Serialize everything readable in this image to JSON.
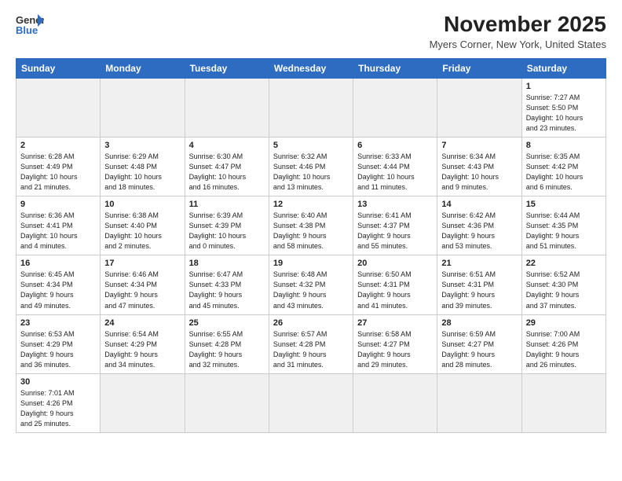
{
  "header": {
    "logo_text_general": "General",
    "logo_text_blue": "Blue",
    "month_title": "November 2025",
    "location": "Myers Corner, New York, United States"
  },
  "weekdays": [
    "Sunday",
    "Monday",
    "Tuesday",
    "Wednesday",
    "Thursday",
    "Friday",
    "Saturday"
  ],
  "weeks": [
    [
      {
        "day": "",
        "info": "",
        "empty": true
      },
      {
        "day": "",
        "info": "",
        "empty": true
      },
      {
        "day": "",
        "info": "",
        "empty": true
      },
      {
        "day": "",
        "info": "",
        "empty": true
      },
      {
        "day": "",
        "info": "",
        "empty": true
      },
      {
        "day": "",
        "info": "",
        "empty": true
      },
      {
        "day": "1",
        "info": "Sunrise: 7:27 AM\nSunset: 5:50 PM\nDaylight: 10 hours\nand 23 minutes.",
        "empty": false
      }
    ],
    [
      {
        "day": "2",
        "info": "Sunrise: 6:28 AM\nSunset: 4:49 PM\nDaylight: 10 hours\nand 21 minutes.",
        "empty": false
      },
      {
        "day": "3",
        "info": "Sunrise: 6:29 AM\nSunset: 4:48 PM\nDaylight: 10 hours\nand 18 minutes.",
        "empty": false
      },
      {
        "day": "4",
        "info": "Sunrise: 6:30 AM\nSunset: 4:47 PM\nDaylight: 10 hours\nand 16 minutes.",
        "empty": false
      },
      {
        "day": "5",
        "info": "Sunrise: 6:32 AM\nSunset: 4:46 PM\nDaylight: 10 hours\nand 13 minutes.",
        "empty": false
      },
      {
        "day": "6",
        "info": "Sunrise: 6:33 AM\nSunset: 4:44 PM\nDaylight: 10 hours\nand 11 minutes.",
        "empty": false
      },
      {
        "day": "7",
        "info": "Sunrise: 6:34 AM\nSunset: 4:43 PM\nDaylight: 10 hours\nand 9 minutes.",
        "empty": false
      },
      {
        "day": "8",
        "info": "Sunrise: 6:35 AM\nSunset: 4:42 PM\nDaylight: 10 hours\nand 6 minutes.",
        "empty": false
      }
    ],
    [
      {
        "day": "9",
        "info": "Sunrise: 6:36 AM\nSunset: 4:41 PM\nDaylight: 10 hours\nand 4 minutes.",
        "empty": false
      },
      {
        "day": "10",
        "info": "Sunrise: 6:38 AM\nSunset: 4:40 PM\nDaylight: 10 hours\nand 2 minutes.",
        "empty": false
      },
      {
        "day": "11",
        "info": "Sunrise: 6:39 AM\nSunset: 4:39 PM\nDaylight: 10 hours\nand 0 minutes.",
        "empty": false
      },
      {
        "day": "12",
        "info": "Sunrise: 6:40 AM\nSunset: 4:38 PM\nDaylight: 9 hours\nand 58 minutes.",
        "empty": false
      },
      {
        "day": "13",
        "info": "Sunrise: 6:41 AM\nSunset: 4:37 PM\nDaylight: 9 hours\nand 55 minutes.",
        "empty": false
      },
      {
        "day": "14",
        "info": "Sunrise: 6:42 AM\nSunset: 4:36 PM\nDaylight: 9 hours\nand 53 minutes.",
        "empty": false
      },
      {
        "day": "15",
        "info": "Sunrise: 6:44 AM\nSunset: 4:35 PM\nDaylight: 9 hours\nand 51 minutes.",
        "empty": false
      }
    ],
    [
      {
        "day": "16",
        "info": "Sunrise: 6:45 AM\nSunset: 4:34 PM\nDaylight: 9 hours\nand 49 minutes.",
        "empty": false
      },
      {
        "day": "17",
        "info": "Sunrise: 6:46 AM\nSunset: 4:34 PM\nDaylight: 9 hours\nand 47 minutes.",
        "empty": false
      },
      {
        "day": "18",
        "info": "Sunrise: 6:47 AM\nSunset: 4:33 PM\nDaylight: 9 hours\nand 45 minutes.",
        "empty": false
      },
      {
        "day": "19",
        "info": "Sunrise: 6:48 AM\nSunset: 4:32 PM\nDaylight: 9 hours\nand 43 minutes.",
        "empty": false
      },
      {
        "day": "20",
        "info": "Sunrise: 6:50 AM\nSunset: 4:31 PM\nDaylight: 9 hours\nand 41 minutes.",
        "empty": false
      },
      {
        "day": "21",
        "info": "Sunrise: 6:51 AM\nSunset: 4:31 PM\nDaylight: 9 hours\nand 39 minutes.",
        "empty": false
      },
      {
        "day": "22",
        "info": "Sunrise: 6:52 AM\nSunset: 4:30 PM\nDaylight: 9 hours\nand 37 minutes.",
        "empty": false
      }
    ],
    [
      {
        "day": "23",
        "info": "Sunrise: 6:53 AM\nSunset: 4:29 PM\nDaylight: 9 hours\nand 36 minutes.",
        "empty": false
      },
      {
        "day": "24",
        "info": "Sunrise: 6:54 AM\nSunset: 4:29 PM\nDaylight: 9 hours\nand 34 minutes.",
        "empty": false
      },
      {
        "day": "25",
        "info": "Sunrise: 6:55 AM\nSunset: 4:28 PM\nDaylight: 9 hours\nand 32 minutes.",
        "empty": false
      },
      {
        "day": "26",
        "info": "Sunrise: 6:57 AM\nSunset: 4:28 PM\nDaylight: 9 hours\nand 31 minutes.",
        "empty": false
      },
      {
        "day": "27",
        "info": "Sunrise: 6:58 AM\nSunset: 4:27 PM\nDaylight: 9 hours\nand 29 minutes.",
        "empty": false
      },
      {
        "day": "28",
        "info": "Sunrise: 6:59 AM\nSunset: 4:27 PM\nDaylight: 9 hours\nand 28 minutes.",
        "empty": false
      },
      {
        "day": "29",
        "info": "Sunrise: 7:00 AM\nSunset: 4:26 PM\nDaylight: 9 hours\nand 26 minutes.",
        "empty": false
      }
    ],
    [
      {
        "day": "30",
        "info": "Sunrise: 7:01 AM\nSunset: 4:26 PM\nDaylight: 9 hours\nand 25 minutes.",
        "empty": false
      },
      {
        "day": "",
        "info": "",
        "empty": true
      },
      {
        "day": "",
        "info": "",
        "empty": true
      },
      {
        "day": "",
        "info": "",
        "empty": true
      },
      {
        "day": "",
        "info": "",
        "empty": true
      },
      {
        "day": "",
        "info": "",
        "empty": true
      },
      {
        "day": "",
        "info": "",
        "empty": true
      }
    ]
  ]
}
